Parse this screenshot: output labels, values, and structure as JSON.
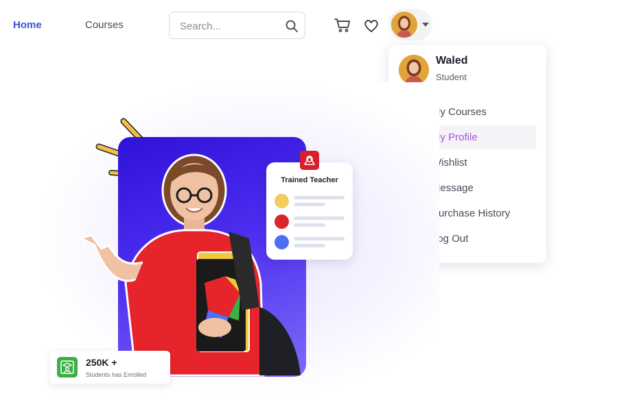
{
  "nav": {
    "home_label": "Home",
    "courses_label": "Courses",
    "search_placeholder": "Search...",
    "accent_color": "#3b4fd8"
  },
  "icons": {
    "search": "search-icon",
    "cart": "cart-icon",
    "wishlist": "heart-icon",
    "caret": "chevron-down-icon"
  },
  "profile_menu": {
    "user_name": "Waled",
    "user_role": "Student",
    "active_color": "#a94ee0",
    "items": [
      {
        "label": "My Courses",
        "icon": "courses-icon",
        "active": false
      },
      {
        "label": "My Profile",
        "icon": "user-icon",
        "active": true
      },
      {
        "label": "Wishlist",
        "icon": "heart-icon",
        "active": false
      },
      {
        "label": "Message",
        "icon": "message-icon",
        "active": false
      },
      {
        "label": "Purchase History",
        "icon": "history-icon",
        "active": false
      },
      {
        "label": "Log Out",
        "icon": "logout-icon",
        "active": false
      }
    ]
  },
  "hero": {
    "trained_card_title": "Trained Teacher",
    "trained_dot_colors": [
      "#f2cc5c",
      "#d9262e",
      "#4f6ff3"
    ],
    "enrolled_value": "250K +",
    "enrolled_label": "Students has Enrolled"
  }
}
